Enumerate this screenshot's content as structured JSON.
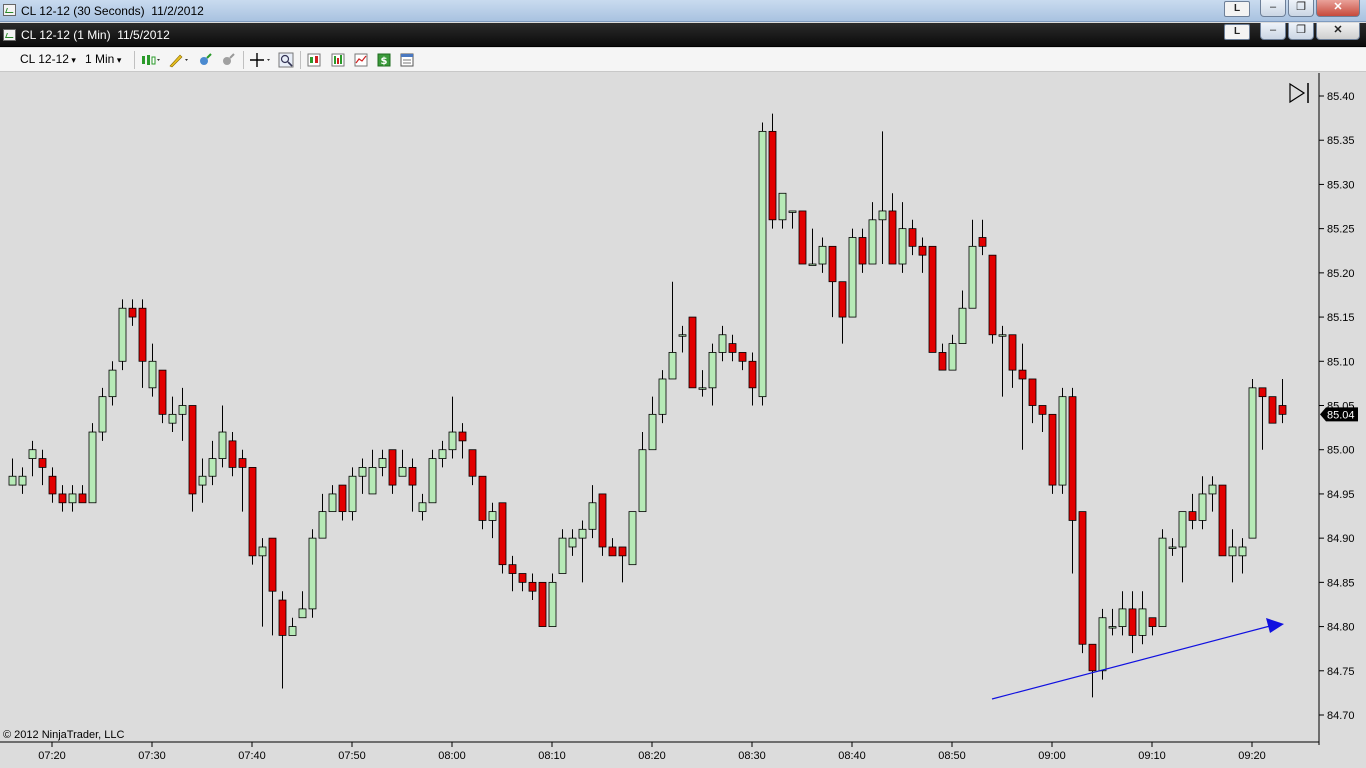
{
  "windows": [
    {
      "title": "CL 12-12 (30 Seconds)  11/2/2012",
      "lock_label": "L"
    },
    {
      "title": "CL 12-12 (1 Min)  11/5/2012",
      "lock_label": "L"
    }
  ],
  "window_buttons": {
    "minimize": "–",
    "restore": "❐",
    "close": "✕"
  },
  "toolbar": {
    "instrument": "CL 12-12",
    "interval": "1 Min",
    "icons": [
      "bar-type-icon",
      "drawing-tool-icon",
      "marker-icon",
      "marker-dim-icon",
      "crosshair-icon",
      "zoom-icon",
      "strategies-icon",
      "indicators-icon",
      "chart-properties-icon",
      "dollar-icon",
      "data-box-icon"
    ]
  },
  "copyright": "© 2012 NinjaTrader, LLC",
  "colors": {
    "up": "#b7eab7",
    "down": "#e30000",
    "wick": "#000000",
    "arrow": "#1010e0",
    "background": "#dcdcdc"
  },
  "chart_data": {
    "type": "candlestick",
    "last_price_label": "85.04",
    "y_ticks": [
      "85.40",
      "85.35",
      "85.30",
      "85.25",
      "85.20",
      "85.15",
      "85.10",
      "85.05",
      "85.00",
      "84.95",
      "84.90",
      "84.85",
      "84.80",
      "84.75",
      "84.70"
    ],
    "x_ticks": [
      "07:20",
      "07:30",
      "07:40",
      "07:50",
      "08:00",
      "08:10",
      "08:20",
      "08:30",
      "08:40",
      "08:50",
      "09:00",
      "09:10",
      "09:20"
    ],
    "ylim": [
      84.67,
      85.43
    ],
    "candles": [
      [
        84.96,
        84.97,
        84.99,
        84.96
      ],
      [
        84.96,
        84.97,
        84.98,
        84.95
      ],
      [
        84.99,
        85.0,
        85.01,
        84.97
      ],
      [
        84.99,
        84.98,
        85.0,
        84.96
      ],
      [
        84.97,
        84.95,
        84.98,
        84.94
      ],
      [
        84.95,
        84.94,
        84.96,
        84.93
      ],
      [
        84.94,
        84.95,
        84.96,
        84.93
      ],
      [
        84.95,
        84.94,
        84.96,
        84.94
      ],
      [
        84.94,
        85.02,
        85.03,
        84.94
      ],
      [
        85.02,
        85.06,
        85.07,
        85.01
      ],
      [
        85.06,
        85.09,
        85.1,
        85.05
      ],
      [
        85.1,
        85.16,
        85.17,
        85.09
      ],
      [
        85.16,
        85.15,
        85.17,
        85.14
      ],
      [
        85.16,
        85.1,
        85.17,
        85.07
      ],
      [
        85.07,
        85.1,
        85.12,
        85.06
      ],
      [
        85.09,
        85.04,
        85.09,
        85.03
      ],
      [
        85.03,
        85.04,
        85.06,
        85.02
      ],
      [
        85.04,
        85.05,
        85.07,
        85.01
      ],
      [
        85.05,
        84.95,
        85.05,
        84.93
      ],
      [
        84.96,
        84.97,
        84.99,
        84.94
      ],
      [
        84.97,
        84.99,
        85.01,
        84.96
      ],
      [
        84.99,
        85.02,
        85.05,
        84.98
      ],
      [
        85.01,
        84.98,
        85.02,
        84.97
      ],
      [
        84.99,
        84.98,
        85.0,
        84.93
      ],
      [
        84.98,
        84.88,
        84.98,
        84.87
      ],
      [
        84.88,
        84.89,
        84.9,
        84.8
      ],
      [
        84.9,
        84.84,
        84.9,
        84.79
      ],
      [
        84.83,
        84.79,
        84.84,
        84.73
      ],
      [
        84.79,
        84.8,
        84.81,
        84.79
      ],
      [
        84.81,
        84.82,
        84.84,
        84.81
      ],
      [
        84.82,
        84.9,
        84.91,
        84.81
      ],
      [
        84.9,
        84.93,
        84.95,
        84.9
      ],
      [
        84.93,
        84.95,
        84.96,
        84.93
      ],
      [
        84.96,
        84.93,
        84.96,
        84.92
      ],
      [
        84.93,
        84.97,
        84.98,
        84.92
      ],
      [
        84.97,
        84.98,
        84.99,
        84.95
      ],
      [
        84.95,
        84.98,
        85.0,
        84.95
      ],
      [
        84.98,
        84.99,
        85.0,
        84.97
      ],
      [
        85.0,
        84.96,
        85.0,
        84.95
      ],
      [
        84.97,
        84.98,
        85.0,
        84.97
      ],
      [
        84.98,
        84.96,
        84.99,
        84.93
      ],
      [
        84.93,
        84.94,
        84.95,
        84.92
      ],
      [
        84.94,
        84.99,
        85.0,
        84.94
      ],
      [
        84.99,
        85.0,
        85.01,
        84.98
      ],
      [
        85.0,
        85.02,
        85.06,
        84.99
      ],
      [
        85.02,
        85.01,
        85.03,
        84.99
      ],
      [
        85.0,
        84.97,
        85.0,
        84.96
      ],
      [
        84.97,
        84.92,
        84.97,
        84.91
      ],
      [
        84.92,
        84.93,
        84.94,
        84.9
      ],
      [
        84.94,
        84.87,
        84.94,
        84.86
      ],
      [
        84.87,
        84.86,
        84.88,
        84.84
      ],
      [
        84.86,
        84.85,
        84.86,
        84.84
      ],
      [
        84.85,
        84.84,
        84.86,
        84.83
      ],
      [
        84.85,
        84.8,
        84.85,
        84.8
      ],
      [
        84.8,
        84.85,
        84.86,
        84.8
      ],
      [
        84.86,
        84.9,
        84.91,
        84.86
      ],
      [
        84.89,
        84.9,
        84.91,
        84.88
      ],
      [
        84.9,
        84.91,
        84.92,
        84.85
      ],
      [
        84.91,
        84.94,
        84.96,
        84.9
      ],
      [
        84.95,
        84.89,
        84.95,
        84.88
      ],
      [
        84.89,
        84.88,
        84.9,
        84.88
      ],
      [
        84.89,
        84.88,
        84.89,
        84.85
      ],
      [
        84.87,
        84.93,
        84.93,
        84.87
      ],
      [
        84.93,
        85.0,
        85.02,
        84.95
      ],
      [
        85.0,
        85.04,
        85.06,
        85.0
      ],
      [
        85.04,
        85.08,
        85.09,
        85.03
      ],
      [
        85.08,
        85.11,
        85.19,
        85.08
      ],
      [
        85.13,
        85.13,
        85.14,
        85.11
      ],
      [
        85.15,
        85.07,
        85.15,
        85.07
      ],
      [
        85.07,
        85.07,
        85.09,
        85.06
      ],
      [
        85.07,
        85.11,
        85.12,
        85.05
      ],
      [
        85.11,
        85.13,
        85.14,
        85.1
      ],
      [
        85.12,
        85.11,
        85.13,
        85.1
      ],
      [
        85.11,
        85.1,
        85.11,
        85.09
      ],
      [
        85.1,
        85.07,
        85.11,
        85.05
      ],
      [
        85.06,
        85.36,
        85.37,
        85.05
      ],
      [
        85.36,
        85.26,
        85.38,
        85.25
      ],
      [
        85.26,
        85.29,
        85.29,
        85.25
      ],
      [
        85.27,
        85.27,
        85.27,
        85.25
      ],
      [
        85.27,
        85.21,
        85.27,
        85.21
      ],
      [
        85.21,
        85.21,
        85.25,
        85.21
      ],
      [
        85.21,
        85.23,
        85.24,
        85.2
      ],
      [
        85.23,
        85.19,
        85.23,
        85.15
      ],
      [
        85.19,
        85.15,
        85.19,
        85.12
      ],
      [
        85.15,
        85.24,
        85.25,
        85.15
      ],
      [
        85.24,
        85.21,
        85.25,
        85.2
      ],
      [
        85.21,
        85.26,
        85.28,
        85.21
      ],
      [
        85.26,
        85.27,
        85.36,
        85.21
      ],
      [
        85.27,
        85.21,
        85.29,
        85.21
      ],
      [
        85.21,
        85.25,
        85.28,
        85.2
      ],
      [
        85.25,
        85.23,
        85.26,
        85.22
      ],
      [
        85.23,
        85.22,
        85.24,
        85.2
      ],
      [
        85.23,
        85.11,
        85.23,
        85.11
      ],
      [
        85.11,
        85.09,
        85.12,
        85.09
      ],
      [
        85.09,
        85.12,
        85.13,
        85.09
      ],
      [
        85.12,
        85.16,
        85.18,
        85.12
      ],
      [
        85.16,
        85.23,
        85.26,
        85.16
      ],
      [
        85.24,
        85.23,
        85.26,
        85.22
      ],
      [
        85.22,
        85.13,
        85.22,
        85.12
      ],
      [
        85.13,
        85.13,
        85.14,
        85.06
      ],
      [
        85.13,
        85.09,
        85.13,
        85.07
      ],
      [
        85.09,
        85.08,
        85.12,
        85.0
      ],
      [
        85.08,
        85.05,
        85.08,
        85.03
      ],
      [
        85.05,
        85.04,
        85.05,
        85.02
      ],
      [
        85.04,
        84.96,
        85.04,
        84.95
      ],
      [
        84.96,
        85.06,
        85.07,
        84.95
      ],
      [
        85.06,
        84.92,
        85.07,
        84.86
      ],
      [
        84.93,
        84.78,
        84.93,
        84.77
      ],
      [
        84.78,
        84.75,
        84.78,
        84.72
      ],
      [
        84.75,
        84.81,
        84.82,
        84.74
      ],
      [
        84.8,
        84.8,
        84.82,
        84.79
      ],
      [
        84.8,
        84.82,
        84.84,
        84.79
      ],
      [
        84.82,
        84.79,
        84.84,
        84.77
      ],
      [
        84.79,
        84.82,
        84.84,
        84.78
      ],
      [
        84.81,
        84.8,
        84.81,
        84.79
      ],
      [
        84.8,
        84.9,
        84.91,
        84.8
      ],
      [
        84.89,
        84.89,
        84.9,
        84.88
      ],
      [
        84.89,
        84.93,
        84.93,
        84.85
      ],
      [
        84.93,
        84.92,
        84.95,
        84.91
      ],
      [
        84.92,
        84.95,
        84.97,
        84.91
      ],
      [
        84.95,
        84.96,
        84.97,
        84.93
      ],
      [
        84.96,
        84.88,
        84.96,
        84.88
      ],
      [
        84.88,
        84.89,
        84.91,
        84.85
      ],
      [
        84.88,
        84.89,
        84.9,
        84.86
      ],
      [
        84.9,
        85.07,
        85.08,
        84.9
      ],
      [
        85.07,
        85.06,
        85.07,
        85.0
      ],
      [
        85.06,
        85.03,
        85.06,
        85.03
      ],
      [
        85.05,
        85.04,
        85.08,
        85.03
      ]
    ]
  }
}
